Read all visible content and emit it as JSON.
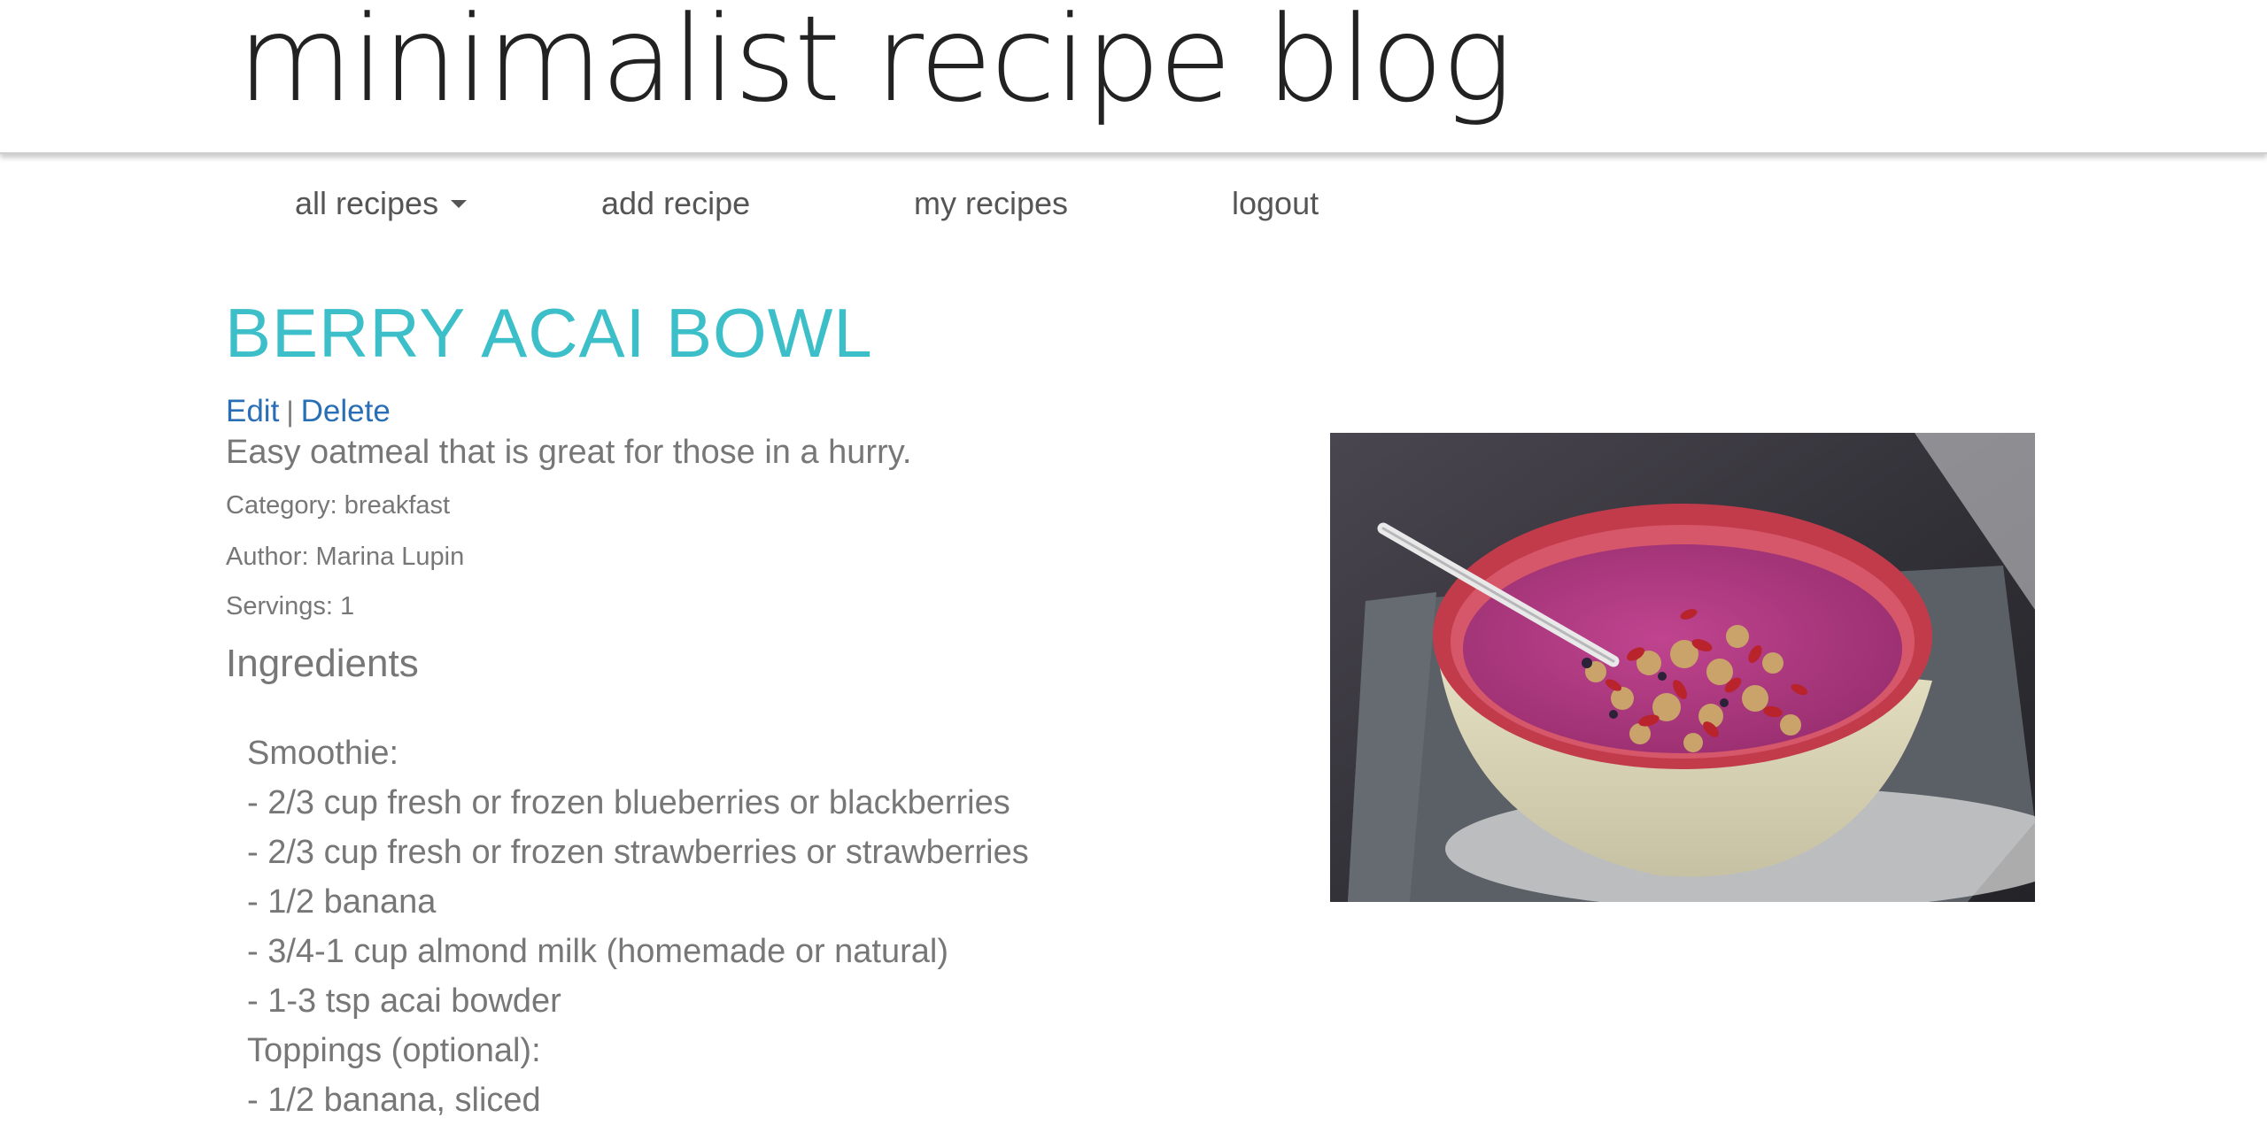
{
  "site": {
    "title": "minimalist recipe blog"
  },
  "nav": {
    "items": [
      {
        "label": "all recipes",
        "has_dropdown": true
      },
      {
        "label": "add recipe"
      },
      {
        "label": "my recipes"
      },
      {
        "label": "logout"
      }
    ]
  },
  "recipe": {
    "title": "BERRY ACAI BOWL",
    "actions": {
      "edit": "Edit",
      "separator": "|",
      "delete": "Delete"
    },
    "description": "Easy oatmeal that is great for those in a hurry.",
    "category": "Category: breakfast",
    "author": "Author: Marina Lupin",
    "servings": "Servings: 1",
    "ingredients_heading": "Ingredients",
    "ingredients": [
      "Smoothie:",
      "- 2/3 cup fresh or frozen blueberries or blackberries",
      "- 2/3 cup fresh or frozen strawberries or strawberries",
      "- 1/2 banana",
      "- 3/4-1 cup almond milk (homemade or natural)",
      "- 1-3 tsp acai bowder",
      "Toppings (optional):",
      "- 1/2 banana, sliced"
    ],
    "photo_icon": "acai-bowl-photo"
  },
  "colors": {
    "title_accent": "#3cbfc8",
    "link": "#2a6fb5",
    "body_text": "#777777",
    "site_title": "#222222"
  }
}
